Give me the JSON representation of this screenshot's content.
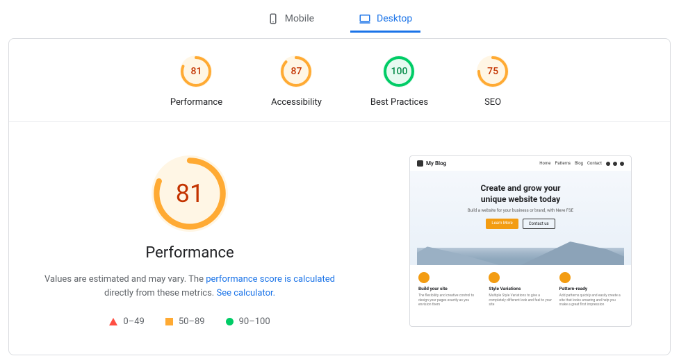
{
  "tabs": {
    "mobile": "Mobile",
    "desktop": "Desktop",
    "active": "desktop"
  },
  "gauges": [
    {
      "score": 81,
      "label": "Performance",
      "color": "#fa3",
      "bg": "#fff6e5"
    },
    {
      "score": 87,
      "label": "Accessibility",
      "color": "#fa3",
      "bg": "#fff6e5"
    },
    {
      "score": 100,
      "label": "Best Practices",
      "color": "#0c6",
      "bg": "#e6faf0"
    },
    {
      "score": 75,
      "label": "SEO",
      "color": "#fa3",
      "bg": "#fff6e5"
    }
  ],
  "perf": {
    "big_score": 81,
    "big_color": "#fa3",
    "big_bg": "#fff6e5",
    "title": "Performance",
    "desc_prefix": "Values are estimated and may vary. The ",
    "desc_link1": "performance score is calculated",
    "desc_mid": " directly from these metrics. ",
    "desc_link2": "See calculator."
  },
  "legend": {
    "low": "0–49",
    "mid": "50–89",
    "high": "90–100"
  },
  "preview": {
    "site_name": "My Blog",
    "nav": [
      "Home",
      "Patterns",
      "Blog",
      "Contact"
    ],
    "hero_line1": "Create and grow your",
    "hero_line2": "unique website today",
    "hero_sub": "Build a website for your business or brand, with Neve FSE",
    "btn_primary": "Learn More",
    "btn_secondary": "Contact us",
    "features": [
      {
        "title": "Build your site",
        "desc": "The flexibility and creative control to design your pages exactly as you envision them"
      },
      {
        "title": "Style Variations",
        "desc": "Multiple Style Variations to give a completely different look and feel to your site"
      },
      {
        "title": "Pattern-ready",
        "desc": "Add patterns quickly and easily create a site that looks amazing and help you make a great first impression"
      }
    ]
  }
}
